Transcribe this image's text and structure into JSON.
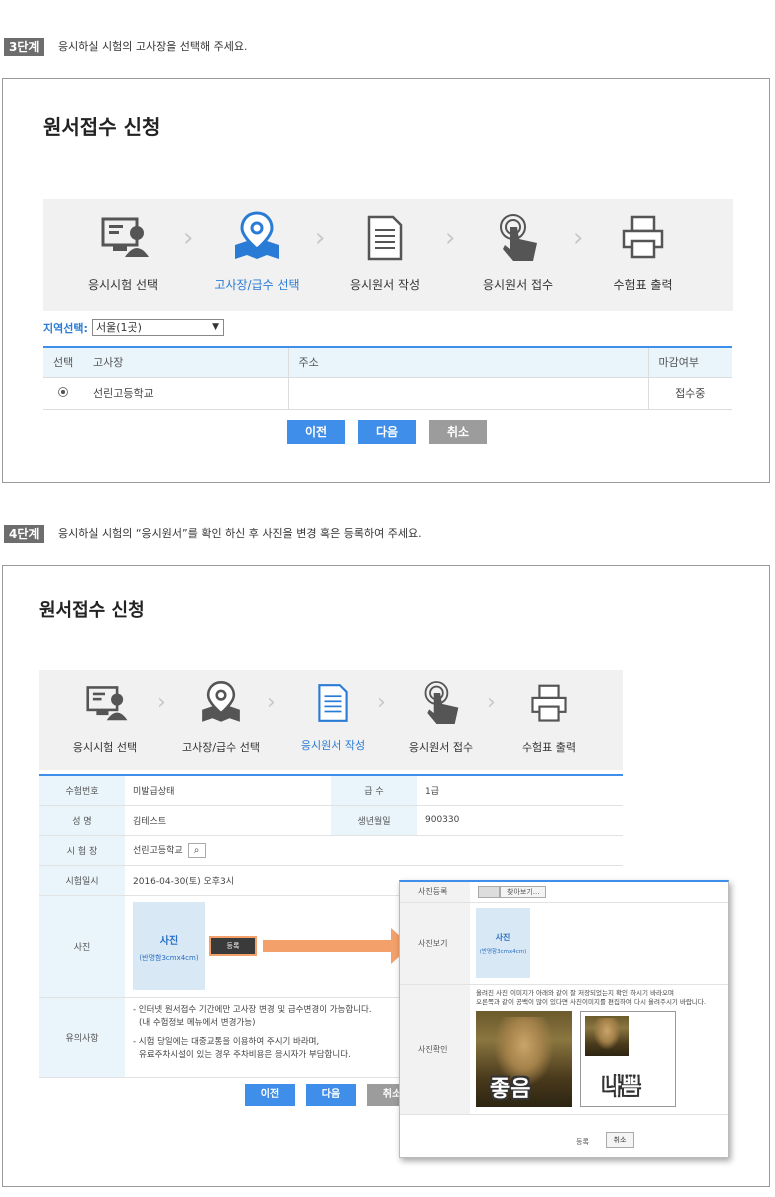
{
  "step3": {
    "badge": "3단계",
    "desc": "응시하실 시험의 고사장을 선택해 주세요.",
    "title": "원서접수 신청",
    "steps": [
      {
        "label": "응시시험 선택",
        "icon": "monitor-person-icon"
      },
      {
        "label": "고사장/급수 선택",
        "icon": "map-pin-icon"
      },
      {
        "label": "응시원서 작성",
        "icon": "document-icon"
      },
      {
        "label": "응시원서 접수",
        "icon": "hand-touch-icon"
      },
      {
        "label": "수험표 출력",
        "icon": "printer-icon"
      }
    ],
    "region_label": "지역선택:",
    "region_value": "서울(1곳)",
    "table": {
      "headers": [
        "선택",
        "고사장",
        "주소",
        "마감여부"
      ],
      "rows": [
        {
          "name": "선린고등학교",
          "address": "",
          "status": "접수중"
        }
      ]
    },
    "buttons": {
      "prev": "이전",
      "next": "다음",
      "cancel": "취소"
    }
  },
  "step4": {
    "badge": "4단계",
    "desc": "응시하실 시험의  “응시원서”를 확인 하신 후 사진을 변경 혹은 등록하여 주세요.",
    "title": "원서접수 신청",
    "steps": [
      {
        "label": "응시시험 선택",
        "icon": "monitor-person-icon"
      },
      {
        "label": "고사장/급수 선택",
        "icon": "map-pin-icon"
      },
      {
        "label": "응시원서 작성",
        "icon": "document-icon"
      },
      {
        "label": "응시원서 접수",
        "icon": "hand-touch-icon"
      },
      {
        "label": "수험표 출력",
        "icon": "printer-icon"
      }
    ],
    "form": {
      "exam_no_label": "수험번호",
      "exam_no": "미발급상태",
      "grade_label": "급   수",
      "grade": "1급",
      "name_label": "성   명",
      "name": "김테스트",
      "birth_label": "생년월일",
      "birth": "900330",
      "site_label": "시 험 장",
      "site": "선린고등학교",
      "datetime_label": "시험일시",
      "datetime": "2016-04-30(토) 오후3시",
      "photo_label": "사진",
      "photo_title": "사진",
      "photo_sub": "(반명함3cmx4cm)",
      "register_btn": "등록",
      "notice_label": "유의사항",
      "notice_1a": "- 인터넷 원서접수 기간에만 고사장 변경 및 급수변경이 가능합니다.",
      "notice_1b": "(내 수험정보 메뉴에서 변경가능)",
      "notice_2a": "- 시험 당일에는 대중교통을 이용하여 주시기 바라며,",
      "notice_2b": "유료주차시설이 있는 경우 주차비용은 응시자가 부담합니다."
    },
    "buttons": {
      "prev": "이전",
      "next": "다음",
      "cancel": "취소"
    },
    "popup": {
      "register_label": "사진등록",
      "browse_btn": "찾아보기...",
      "view_label": "사진보기",
      "photo_title": "사진",
      "photo_sub": "(반명함3cmx4cm)",
      "check_label": "사진확인",
      "check_text_1": "올려진 사진 이미지가 아래와 같이 잘 저장되었는지 확인 하시기 바라오며",
      "check_text_2": "오른쪽과 같이 공백이 많이 있다면 사진이미지를 편집하여 다시 올려주시기 바랍니다.",
      "good_label": "좋음",
      "bad_label": "나쁨",
      "submit": "등록",
      "cancel": "취소"
    }
  },
  "colors": {
    "accent": "#3e8eea",
    "active_step": "#2a7bd5",
    "arrow": "#f4a06a",
    "header_bg": "#e9f4fb"
  }
}
